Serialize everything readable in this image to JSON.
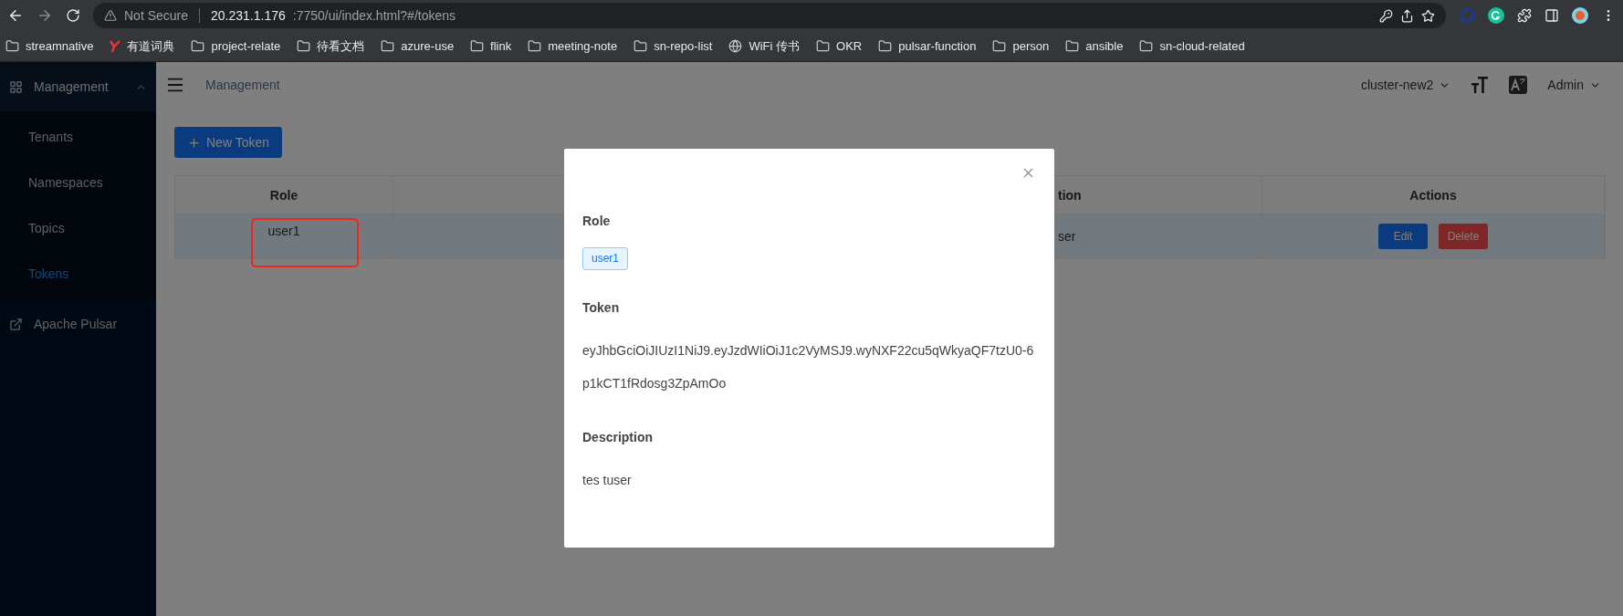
{
  "browser": {
    "security": "Not Secure",
    "host": "20.231.1.176",
    "path": ":7750/ui/index.html?#/tokens",
    "bookmarks": [
      {
        "label": "streamnative",
        "kind": "folder"
      },
      {
        "label": "有道词典",
        "kind": "app"
      },
      {
        "label": "project-relate",
        "kind": "folder"
      },
      {
        "label": "待看文档",
        "kind": "folder"
      },
      {
        "label": "azure-use",
        "kind": "folder"
      },
      {
        "label": "flink",
        "kind": "folder"
      },
      {
        "label": "meeting-note",
        "kind": "folder"
      },
      {
        "label": "sn-repo-list",
        "kind": "folder"
      },
      {
        "label": "WiFi 传书",
        "kind": "web"
      },
      {
        "label": "OKR",
        "kind": "folder"
      },
      {
        "label": "pulsar-function",
        "kind": "folder"
      },
      {
        "label": "person",
        "kind": "folder"
      },
      {
        "label": "ansible",
        "kind": "folder"
      },
      {
        "label": "sn-cloud-related",
        "kind": "folder"
      }
    ]
  },
  "sidebar": {
    "group": {
      "label": "Management",
      "expanded": true,
      "children": [
        {
          "label": "Tenants",
          "selected": false
        },
        {
          "label": "Namespaces",
          "selected": false
        },
        {
          "label": "Topics",
          "selected": false
        },
        {
          "label": "Tokens",
          "selected": true
        }
      ]
    },
    "link": "Apache Pulsar"
  },
  "header": {
    "breadcrumb": "Management",
    "cluster": "cluster-new2",
    "user": "Admin"
  },
  "new_button": "New Token",
  "table": {
    "columns": [
      "Role",
      "tion",
      "Actions"
    ],
    "rows": [
      {
        "role": "user1",
        "column_3": "ser",
        "selected": true,
        "actions": [
          {
            "label": "Edit",
            "kind": "primary"
          },
          {
            "label": "Delete",
            "kind": "danger"
          }
        ]
      }
    ]
  },
  "modal": {
    "sections": [
      {
        "label": "Role",
        "kind": "tag",
        "values": [
          "user1"
        ]
      },
      {
        "label": "Token",
        "kind": "text",
        "values": [
          "eyJhbGciOiJIUzI1NiJ9.eyJzdWIiOiJ1c2VyMSJ9.wyNXF22cu5qWkyaQF7tzU0-6",
          "p1kCT1fRdosg3ZpAmOo"
        ]
      },
      {
        "label": "Description",
        "kind": "text",
        "values": [
          "tes tuser"
        ]
      }
    ]
  }
}
